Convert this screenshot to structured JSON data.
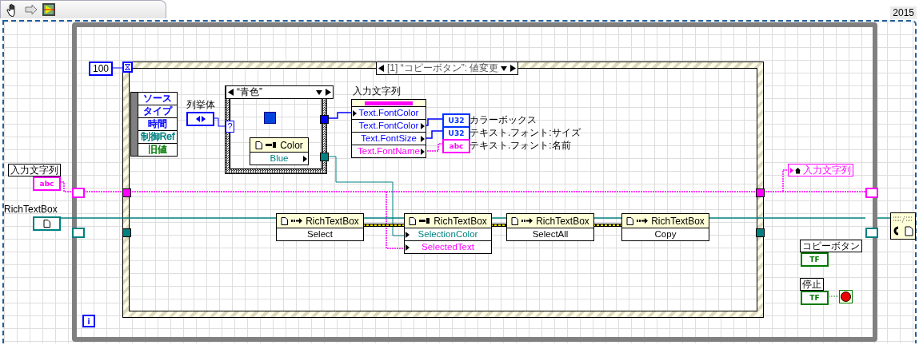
{
  "toolbar": {
    "version": "2015"
  },
  "while_loop": {
    "timer_constant": "100",
    "iteration_terminal": "i"
  },
  "event_structure": {
    "selector": "[1] “コピーボタン”: 値変更",
    "event_data": [
      {
        "name": "ソース",
        "color": "#0000ff"
      },
      {
        "name": "タイプ",
        "color": "#0000ff"
      },
      {
        "name": "時間",
        "color": "#0000ff"
      },
      {
        "name": "制御Ref",
        "color": "#008080"
      },
      {
        "name": "旧値",
        "color": "#007a00"
      }
    ]
  },
  "enum_constant": {
    "label": "列挙体",
    "selector_mark": "?"
  },
  "case_structure": {
    "selector": "“青色”"
  },
  "color_node": {
    "class": "Color",
    "item": "Blue"
  },
  "property_node": {
    "label": "入力文字列",
    "properties": [
      {
        "name": "Text.FontColor",
        "kind": "write",
        "color": "#0000ff"
      },
      {
        "name": "Text.FontColor",
        "kind": "read",
        "color": "#0000ff"
      },
      {
        "name": "Text.FontSize",
        "kind": "read",
        "color": "#0000ff"
      },
      {
        "name": "Text.FontName",
        "kind": "read",
        "color": "#ff00ff"
      }
    ]
  },
  "indicators": [
    {
      "type_label": "U32",
      "label": "カラーボックス",
      "color": "#0033ff"
    },
    {
      "type_label": "U32",
      "label": "テキスト.フォント:サイズ",
      "color": "#0033ff"
    },
    {
      "type_label": "abc",
      "label": "テキスト.フォント:名前",
      "color": "#ff00ff"
    }
  ],
  "controls": [
    {
      "label": "入力文字列",
      "type_label": "abc",
      "kind": "string"
    },
    {
      "label": "RichTextBox",
      "kind": "refnum"
    }
  ],
  "method_nodes": [
    {
      "kind": "invoke",
      "class": "RichTextBox",
      "members": [
        {
          "name": "Select",
          "color": "#000000"
        }
      ]
    },
    {
      "kind": "property",
      "class": "RichTextBox",
      "members": [
        {
          "name": "SelectionColor",
          "color": "#008080"
        },
        {
          "name": "SelectedText",
          "color": "#ff00ff"
        }
      ]
    },
    {
      "kind": "invoke",
      "class": "RichTextBox",
      "members": [
        {
          "name": "SelectAll",
          "color": "#000000"
        }
      ]
    },
    {
      "kind": "invoke",
      "class": "RichTextBox",
      "members": [
        {
          "name": "Copy",
          "color": "#000000"
        }
      ]
    }
  ],
  "local_variable": {
    "label": "入力文字列"
  },
  "boolean_terminals": [
    {
      "label": "コピーボタン",
      "type_label": "TF"
    },
    {
      "label": "停止",
      "type_label": "TF"
    }
  ]
}
